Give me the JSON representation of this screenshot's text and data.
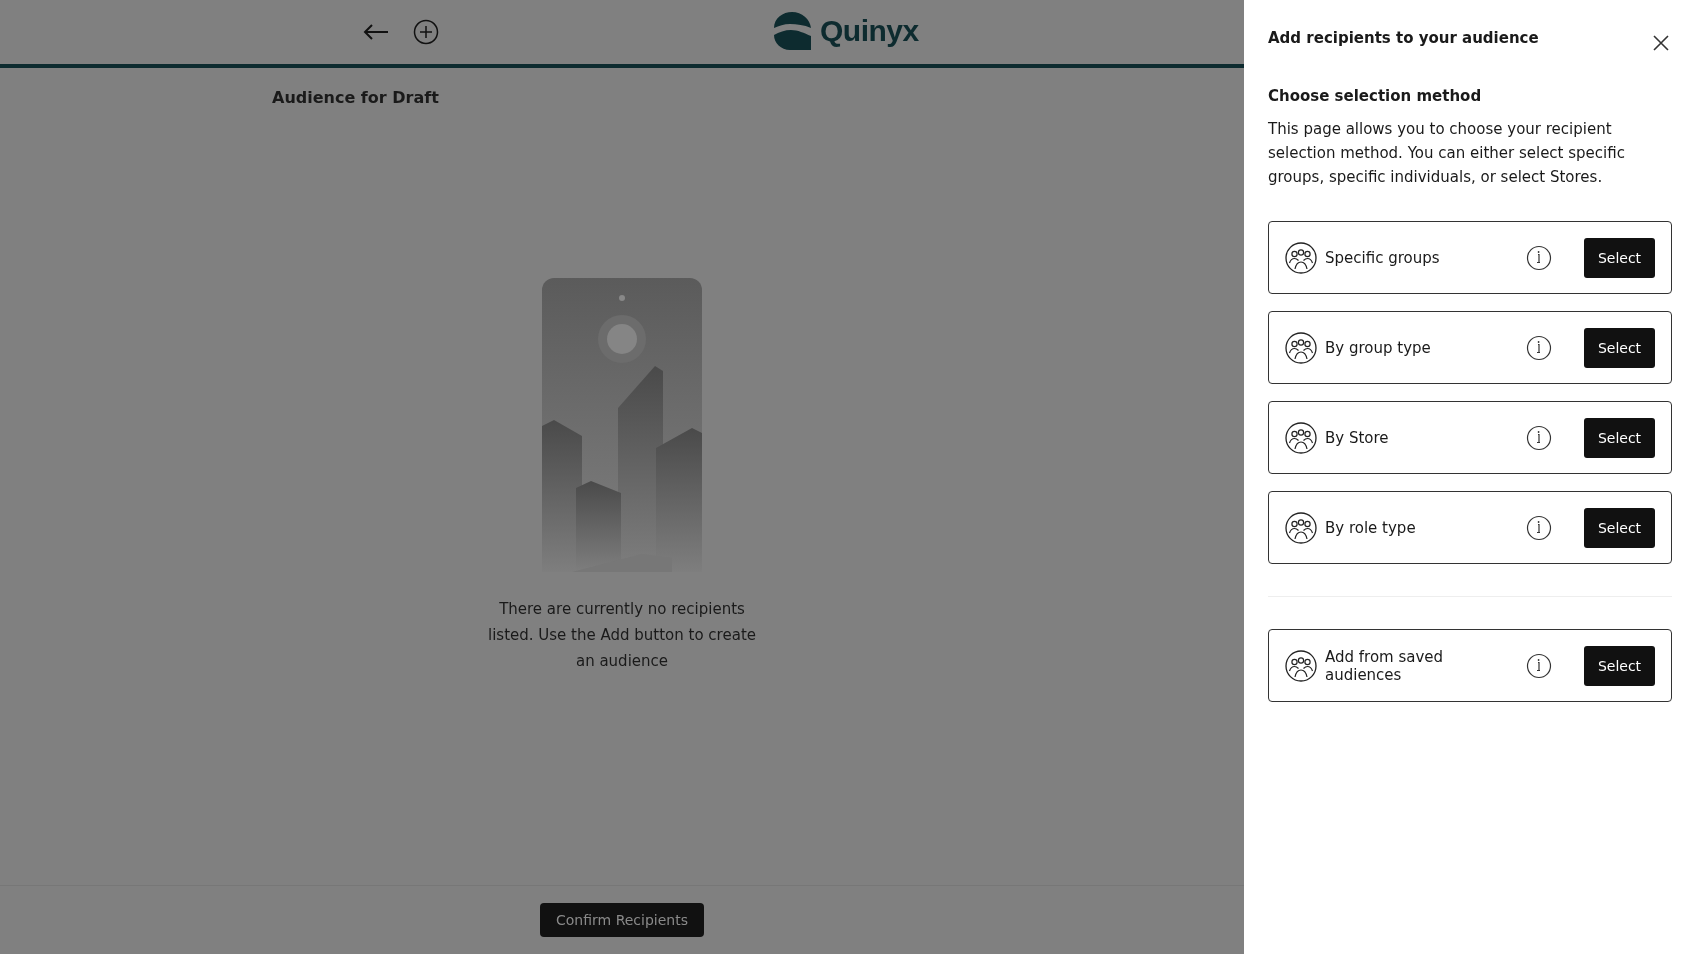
{
  "header": {
    "logo_text": "Quinyx"
  },
  "page": {
    "title": "Audience for Draft",
    "empty_message": "There are currently no recipients listed. Use the Add button to create an audience",
    "confirm_button": "Confirm Recipients"
  },
  "panel": {
    "title": "Add recipients to your audience",
    "section_title": "Choose selection method",
    "description": "This page allows you to choose your recipient selection method. You can either select specific groups, specific individuals, or select Stores.",
    "methods": [
      {
        "label": "Specific groups",
        "button": "Select"
      },
      {
        "label": "By group type",
        "button": "Select"
      },
      {
        "label": "By Store",
        "button": "Select"
      },
      {
        "label": "By role type",
        "button": "Select"
      }
    ],
    "saved_methods": [
      {
        "label": "Add from saved audiences",
        "button": "Select"
      }
    ]
  }
}
